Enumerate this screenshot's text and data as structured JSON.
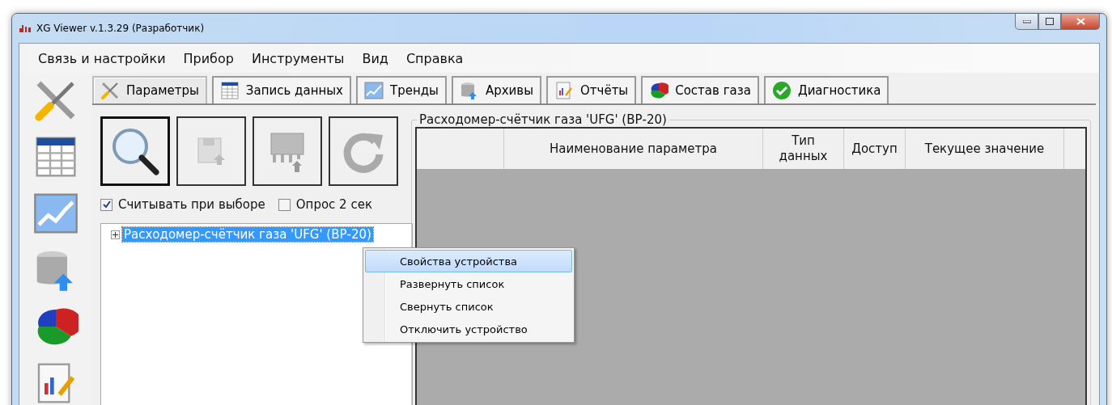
{
  "window": {
    "title": "XG Viewer v.1.3.29 (Разработчик)"
  },
  "menu": [
    "Связь и настройки",
    "Прибор",
    "Инструменты",
    "Вид",
    "Справка"
  ],
  "tabs": [
    {
      "label": "Параметры",
      "kind": "tools",
      "selected": true
    },
    {
      "label": "Запись данных",
      "kind": "table",
      "selected": false
    },
    {
      "label": "Тренды",
      "kind": "chart",
      "selected": false
    },
    {
      "label": "Архивы",
      "kind": "database",
      "selected": false
    },
    {
      "label": "Отчёты",
      "kind": "report",
      "selected": false
    },
    {
      "label": "Состав газа",
      "kind": "pie",
      "selected": false
    },
    {
      "label": "Диагностика",
      "kind": "check",
      "selected": false
    }
  ],
  "sidebar": {
    "items": [
      {
        "kind": "tools"
      },
      {
        "kind": "table"
      },
      {
        "kind": "chart"
      },
      {
        "kind": "database"
      },
      {
        "kind": "pie"
      },
      {
        "kind": "report"
      }
    ]
  },
  "action_buttons": [
    {
      "kind": "read",
      "disabled": false
    },
    {
      "kind": "save",
      "disabled": true
    },
    {
      "kind": "chip",
      "disabled": true
    },
    {
      "kind": "refresh",
      "disabled": true
    }
  ],
  "options": [
    {
      "label": "Считывать при выборе",
      "checked": true
    },
    {
      "label": "Опрос 2 сек",
      "checked": false
    }
  ],
  "tree": {
    "items": [
      {
        "label": "Расходомер-счётчик газа 'UFG' (ВР-20)",
        "selected": true,
        "expanded": false
      }
    ]
  },
  "panel": {
    "title": "Расходомер-счётчик газа 'UFG' (ВР-20)",
    "table": {
      "columns": [
        "Наименование параметра",
        "Тип данных",
        "Доступ",
        "Текущее значение"
      ]
    }
  },
  "context_menu": {
    "items": [
      {
        "label": "Свойства устройства",
        "selected": true
      },
      {
        "label": "Развернуть список",
        "selected": false
      },
      {
        "label": "Свернуть список",
        "selected": false
      },
      {
        "label": "Отключить устройство",
        "selected": false
      }
    ]
  }
}
